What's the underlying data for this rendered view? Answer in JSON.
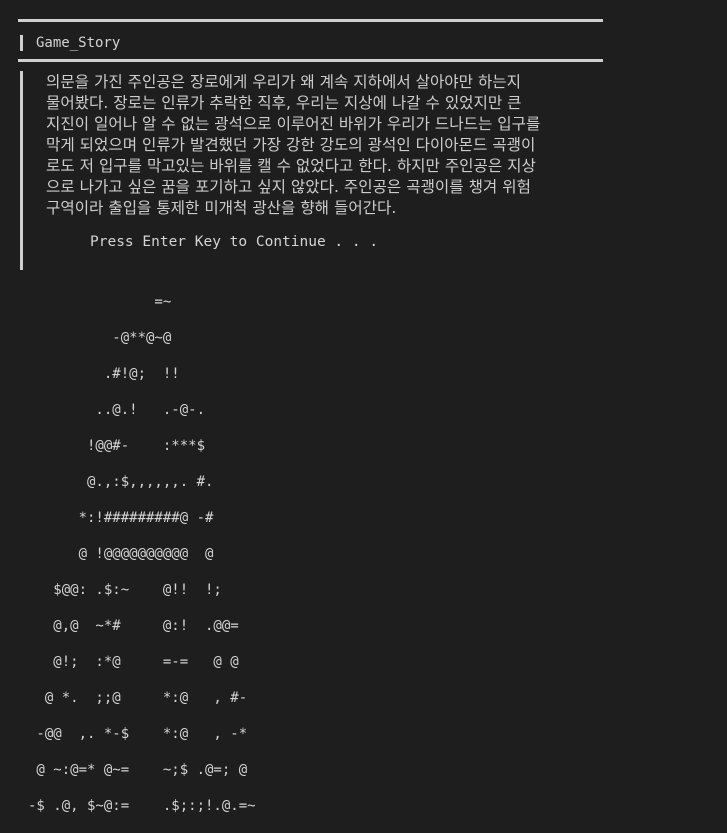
{
  "window": {
    "title": "Game_Story"
  },
  "story": {
    "lines": [
      "의문을 가진 주인공은 장로에게 우리가 왜 계속 지하에서 살아야만 하는지",
      "물어봤다. 장로는 인류가 추락한 직후, 우리는 지상에 나갈 수 있었지만 큰",
      "지진이 일어나 알 수 없는 광석으로 이루어진 바위가 우리가 드나드는 입구를",
      "막게 되었으며 인류가 발견했던 가장 강한 강도의 광석인 다이아몬드 곡괭이",
      "로도 저 입구를 막고있는 바위를 캘 수 없었다고 한다. 하지만 주인공은 지상",
      "으로 나가고 싶은 꿈을 포기하고 싶지 않았다. 주인공은 곡괭이를 챙겨 위험",
      "구역이라 출입을 통제한 미개척 광산을 향해 들어간다."
    ],
    "prompt": "Press Enter Key to Continue . . ."
  },
  "ascii_art": [
    "               =~",
    "          -@**@~@",
    "         .#!@;  !!",
    "        ..@.!   .-@-.",
    "       !@@#-    :***$",
    "       @.,:$,,,,,,. #.",
    "      *:!#########@ -#",
    "      @ !@@@@@@@@@@  @",
    "   $@@: .$:~    @!!  !;",
    "   @,@  ~*#     @:!  .@@=",
    "   @!;  :*@     =-=   @ @",
    "  @ *.  ;;@     *:@   , #-",
    " -@@  ,. *-$    *:@   , -*",
    " @ ~:@=* @~=    ~;$ .@=; @",
    "-$ .@, $~@:=    .$;:;!.@.=~"
  ]
}
